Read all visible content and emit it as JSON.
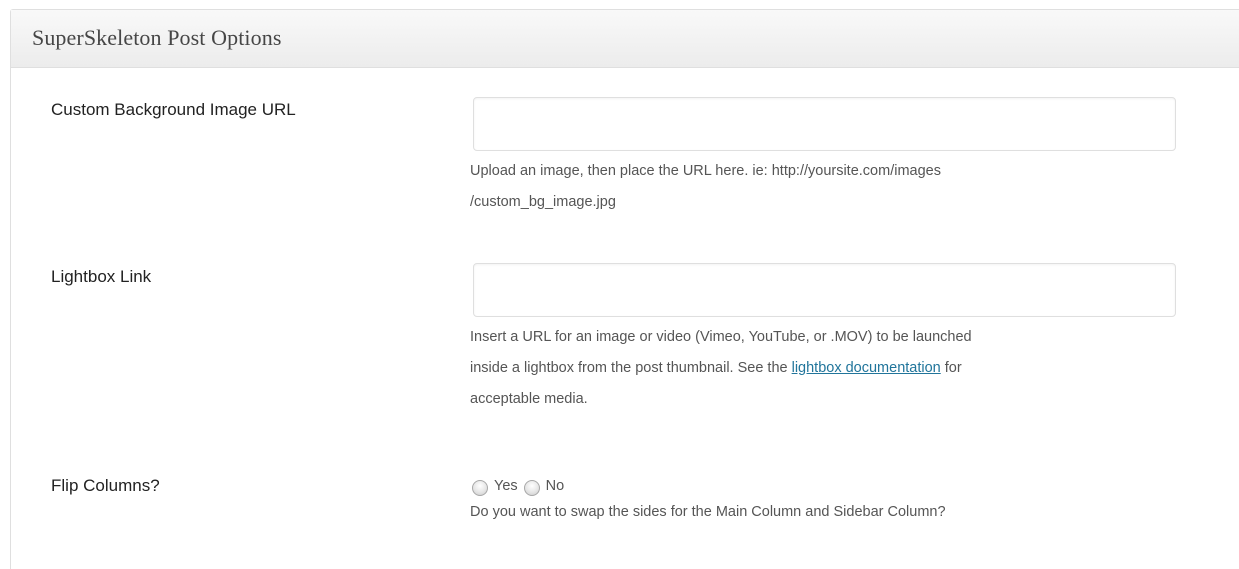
{
  "metabox": {
    "title": "SuperSkeleton Post Options"
  },
  "fields": {
    "background_image": {
      "label": "Custom Background Image URL",
      "value": "",
      "description_line1": "Upload an image, then place the URL here. ie: http://yoursite.com/images",
      "description_line2": "/custom_bg_image.jpg"
    },
    "lightbox_link": {
      "label": "Lightbox Link",
      "value": "",
      "description_line1": "Insert a URL for an image or video (Vimeo, YouTube, or .MOV) to be launched",
      "description_line2_before": "inside a lightbox from the post thumbnail. See the ",
      "description_link": "lightbox documentation",
      "description_line2_after": " for",
      "description_line3": "acceptable media."
    },
    "flip_columns": {
      "label": "Flip Columns?",
      "option_yes": "Yes",
      "option_no": "No",
      "description": "Do you want to swap the sides for the Main Column and Sidebar Column?"
    }
  }
}
